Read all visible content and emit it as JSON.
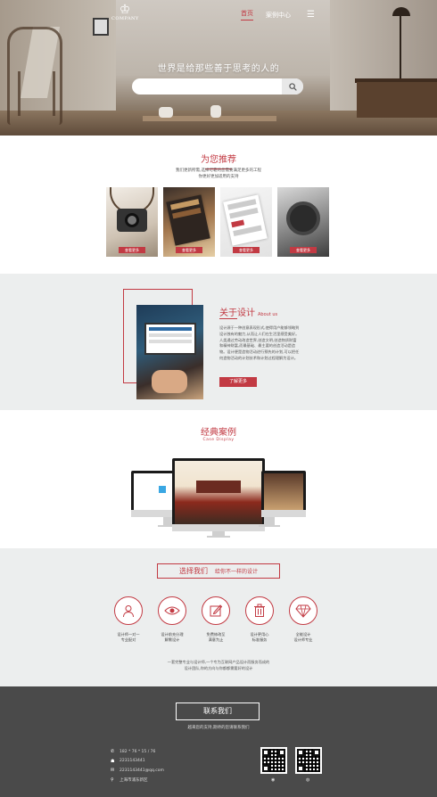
{
  "header": {
    "logo_text": "COMPANY",
    "nav": {
      "home": "首页",
      "case_center": "案例中心"
    },
    "slogan": "世界是给那些善于思考的人的",
    "search_placeholder": ""
  },
  "recommend": {
    "title": "为您推荐",
    "desc_line1": "我们更新所需,选择可靠的您需要满足更多的工程",
    "desc_line2": "你更好更加适用的支持",
    "cards": [
      {
        "button": "查看更多"
      },
      {
        "button": "查看更多"
      },
      {
        "button": "查看更多"
      },
      {
        "button": "查看更多"
      }
    ]
  },
  "about": {
    "title": "关于设计",
    "title_en": "About us",
    "body": "设计源于一种创意表现形式,使得用户能够领略到设计独有的魅力,从而让人们在生活里感受美好。人类通过劳动改造世界,创造文明,创造物质财富和精神财富,而最基础、最主要的创造活动是造物。设计便是造物活动进行预先的计划,可以把任何造物活动的计划技术和计划过程理解为设计。",
    "more": "了解更多"
  },
  "cases": {
    "title": "经典案例",
    "subtitle": "Case Display"
  },
  "choose": {
    "title": "选择我们",
    "subtitle": "给你不一样的设计",
    "features": [
      {
        "line1": "设计师一对一",
        "line2": "专业配对",
        "icon": "user-icon"
      },
      {
        "line1": "设计前充分理",
        "line2": "解需设计",
        "icon": "eye-icon"
      },
      {
        "line1": "免费修改至",
        "line2": "满意为止",
        "icon": "edit-icon"
      },
      {
        "line1": "设计更用心",
        "line2": "标准服务",
        "icon": "trash-icon"
      },
      {
        "line1": "全能设计",
        "line2": "设计师专业",
        "icon": "diamond-icon"
      }
    ],
    "note_line1": "一套完整专业与设计师,一个专为互联网产品设计而服务而成的",
    "note_line2": "设计团队,你的方向与你都都需要好的设计"
  },
  "footer": {
    "contact_button": "联系我们",
    "subtitle": "越来您的支持,期待的您请联系我们",
    "phone": "182 * 76 * 15 / 76",
    "qq": "2231143441",
    "email": "2231143441@qq.com",
    "address": "上海市浦东新区"
  },
  "colors": {
    "accent": "#c23a43",
    "footer_bg": "#4a4a4a",
    "section_bg": "#eceeee"
  }
}
